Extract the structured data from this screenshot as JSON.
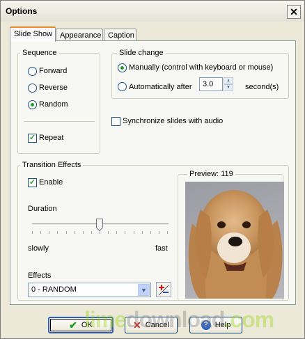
{
  "window": {
    "title": "Options"
  },
  "tabs": [
    {
      "label": "Slide Show",
      "active": true
    },
    {
      "label": "Appearance",
      "active": false
    },
    {
      "label": "Caption",
      "active": false
    }
  ],
  "sequence": {
    "label": "Sequence",
    "options": [
      {
        "label": "Forward",
        "checked": false
      },
      {
        "label": "Reverse",
        "checked": false
      },
      {
        "label": "Random",
        "checked": true
      }
    ],
    "repeat": {
      "label": "Repeat",
      "checked": true
    }
  },
  "slide_change": {
    "label": "Slide change",
    "manual": {
      "label": "Manually (control with keyboard or mouse)",
      "checked": true
    },
    "auto": {
      "label": "Automatically after",
      "checked": false,
      "value": "3.0",
      "unit": "second(s)"
    }
  },
  "sync_audio": {
    "label": "Synchronize slides with audio",
    "checked": false
  },
  "transition": {
    "label": "Transition Effects",
    "enable": {
      "label": "Enable",
      "checked": true
    },
    "duration_label": "Duration",
    "duration_value": 0.5,
    "slow_label": "slowly",
    "fast_label": "fast",
    "effects_label": "Effects",
    "effects_selected": "0 - RANDOM"
  },
  "preview": {
    "label": "Preview: 119"
  },
  "buttons": {
    "ok": "OK",
    "cancel": "Cancel",
    "help": "Help"
  },
  "watermark": {
    "lime": "lime",
    "download": "download",
    "com": ".com"
  },
  "colors": {
    "accent_tab": "#e68b2c",
    "check_green": "#21a121",
    "lime": "#8fd400",
    "download": "#7a7a7a"
  }
}
